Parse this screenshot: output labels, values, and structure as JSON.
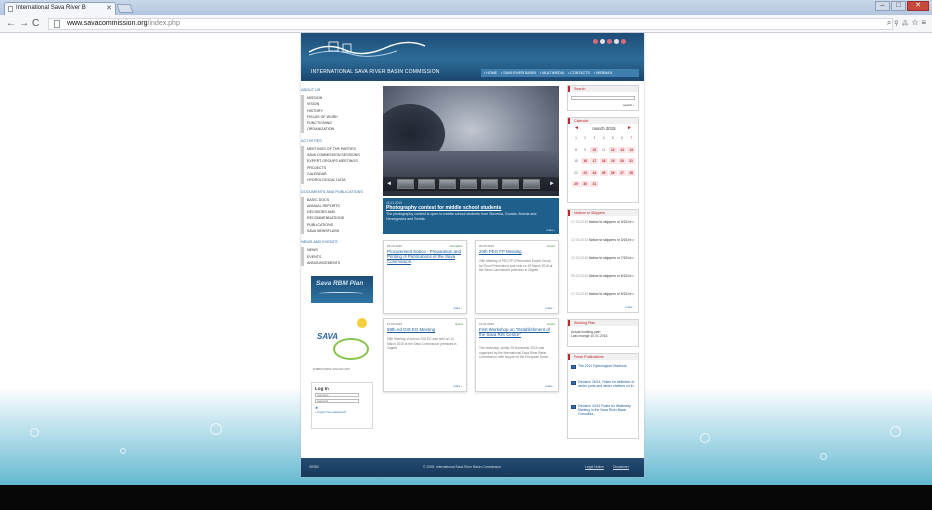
{
  "browser": {
    "tab_title": "International Sava River B",
    "url_domain": "www.savacommission.org",
    "url_path": "/index.php"
  },
  "site": {
    "org_name": "INTERNATIONAL SAVA RIVER BASIN COMMISSION",
    "top_nav": [
      "• HOME",
      "• SAVA RIVER BASIN",
      "• MULTIMEDIA",
      "• CONTACTS",
      "• WEBMAIL"
    ],
    "left": {
      "about_title": "ABOUT US",
      "about_items": [
        "MISSION",
        "VISION",
        "HISTORY",
        "FIELDS OF WORK",
        "FUNCTIONING",
        "ORGANIZATION"
      ],
      "activities_title": "ACTIVITIES",
      "activities_items": [
        "MEETINGS OF THE PARTIES",
        "SAVA COMMISSION SESSIONS",
        "EXPERT GROUPS MEETINGS",
        "PROJECTS",
        "CALENDAR",
        "HYDROLOGICAL DATA"
      ],
      "docs_title": "DOCUMENTS AND PUBLICATIONS",
      "docs_items": [
        "BASIC DOCS",
        "ANNUAL REPORTS",
        "DECISIONS AND",
        "RECOMMENDATIONS",
        "PUBLICATIONS",
        "SAVA NEWSFLASH"
      ],
      "news_title": "NEWS AND EVENTS",
      "news_items": [
        "NEWS",
        "EVENTS",
        "ANNOUNCEMENTS"
      ],
      "rbm_banner": "Sava RBM Plan",
      "sava_logo": "SAVA",
      "sava_sub": "INTERNATIONAL SAVA DAY 2015",
      "login_title": "Log In",
      "username_placeholder": "username",
      "password_placeholder": "password",
      "forgot": "» Forgot Your password?"
    },
    "feature": {
      "date": "24.03.2015",
      "title": "Photography contest for middle school students",
      "text": "The photography contest is open to middle school students from Slovenia, Croatia, Bosnia and Herzegovina and Serbia.",
      "more": "more ›"
    },
    "cards": [
      {
        "date": "25.03.2015",
        "category": "Animation",
        "title": "Procurement Notice - Preparation and Printing of Publications of the Sava Commission",
        "text": "",
        "more": "more ›"
      },
      {
        "date": "20.03.2015",
        "category": "Event",
        "title": "20th PEG FP Meeting",
        "text": "20th Meeting of PEG FP (Permanent Expert Group for Flood Prevention) was held on 19 March 2015 at the Sava Commission premises in Zagreb.",
        "more": "more ›"
      },
      {
        "date": "13.03.2015",
        "category": "Event",
        "title": "59th Ad GIS EG Meeting",
        "text": "59th Meeting of Ad hoc GIS EG was held on 12 March 2015 at the Sava Commission premises in Zagreb.",
        "more": "more ›"
      },
      {
        "date": "16.02.2015",
        "category": "Event",
        "title": "First Workshop on \"Establishment of the Sava RIS Centre\"",
        "text": "The workshop, jointly, 25 November 2014 was organized by the International Sava River Basin Commission, with support of the European Union, ...",
        "more": "more ›"
      }
    ],
    "right": {
      "search_title": "Search",
      "search_btn": "search ›",
      "calendar_title": "Calendar",
      "month": "march 2015",
      "days": [
        "1",
        "2",
        "3",
        "4",
        "5",
        "6",
        "7",
        "8",
        "9",
        "10",
        "11",
        "12",
        "13",
        "14",
        "15",
        "16",
        "17",
        "18",
        "19",
        "20",
        "21",
        "22",
        "23",
        "24",
        "25",
        "26",
        "27",
        "28",
        "29",
        "30",
        "31"
      ],
      "notices_title": "Notices to Skippers",
      "notices": [
        {
          "date": "17.03.2015",
          "text": "Notice to skippers nr 3/15-hr-r"
        },
        {
          "date": "12.03.2015",
          "text": "Notice to skippers nr 3/15-hr-r"
        },
        {
          "date": "10.03.2015",
          "text": "Notice to skippers nr 7/15-hr-r"
        },
        {
          "date": "09.03.2015",
          "text": "Notice to skippers nr 6/15-hr-r"
        },
        {
          "date": "17.03.2015",
          "text": "Notice to skippers nr 5/15-hr-r"
        }
      ],
      "notices_more": "more ›",
      "working_title": "Working Plan",
      "working_text": "Actual working plan\nLast change 10.01.2015.",
      "fresh_title": "Fresh Publications",
      "pubs": [
        "The 2011 Hydrological Yearbook",
        "Decision 26/14, Rules for definition of winter ports and winter shelters on th...",
        "Decision 43/14 Rules for Waterway Marking in the Sava River Basin Consolida..."
      ]
    },
    "footer": {
      "left": "ISRBC",
      "copy": "© 2008, International Sava River Basin Commission",
      "legal": "Legal Notice",
      "sitemap": "Disclaimer"
    }
  }
}
